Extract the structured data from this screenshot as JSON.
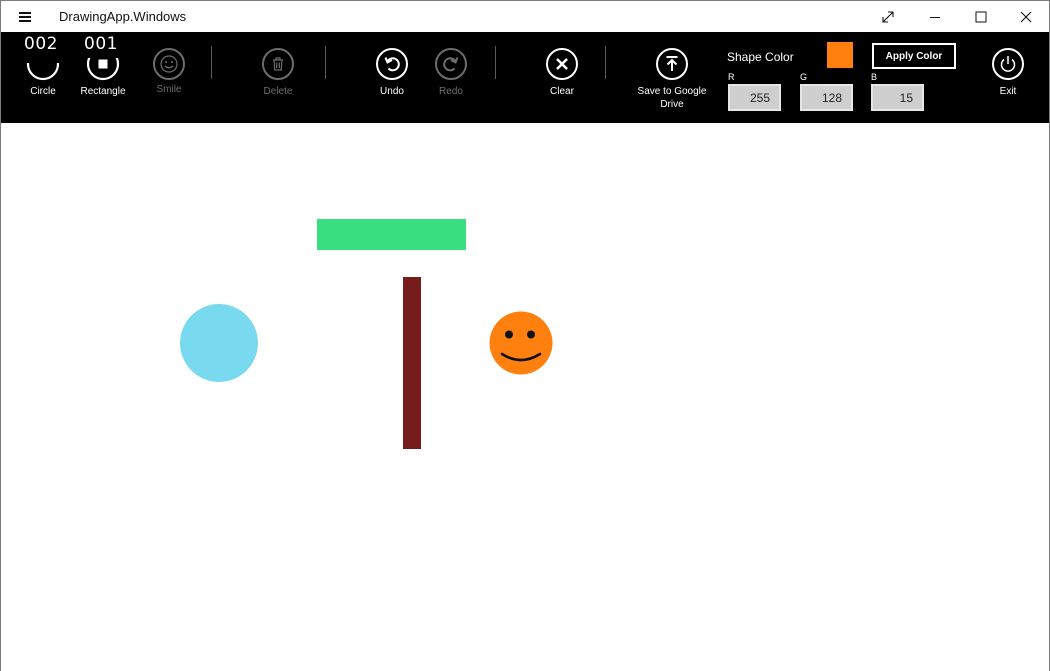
{
  "window": {
    "title": "DrawingApp.Windows",
    "icons": [
      "hamburger-menu-icon",
      "fullscreen-icon",
      "minimize-icon",
      "maximize-icon",
      "close-icon"
    ]
  },
  "toolbar": {
    "circle": {
      "label": "Circle",
      "count": "002",
      "icon": "circle-icon",
      "enabled": true
    },
    "rectangle": {
      "label": "Rectangle",
      "count": "001",
      "icon": "rectangle-icon",
      "enabled": true
    },
    "smile": {
      "label": "Smile",
      "icon": "smile-icon",
      "enabled": false
    },
    "delete": {
      "label": "Delete",
      "icon": "trash-icon",
      "enabled": false
    },
    "undo": {
      "label": "Undo",
      "icon": "undo-icon",
      "enabled": true
    },
    "redo": {
      "label": "Redo",
      "icon": "redo-icon",
      "enabled": false
    },
    "clear": {
      "label": "Clear",
      "icon": "clear-x-icon",
      "enabled": true
    },
    "save": {
      "label": "Save to Google Drive",
      "icon": "upload-icon",
      "enabled": true
    },
    "exit": {
      "label": "Exit",
      "icon": "power-icon",
      "enabled": true
    }
  },
  "shape_color": {
    "label": "Shape Color",
    "swatch": "#ff800f",
    "apply_label": "Apply Color",
    "r_label": "R",
    "g_label": "G",
    "b_label": "B",
    "r": "255",
    "g": "128",
    "b": "15"
  },
  "canvas_shapes": [
    {
      "kind": "rectangle",
      "color": "#3ae07f"
    },
    {
      "kind": "circle",
      "color": "#79d9ee"
    },
    {
      "kind": "rectangle",
      "color": "#761c1c"
    },
    {
      "kind": "smiley",
      "color": "#ff800f"
    }
  ]
}
